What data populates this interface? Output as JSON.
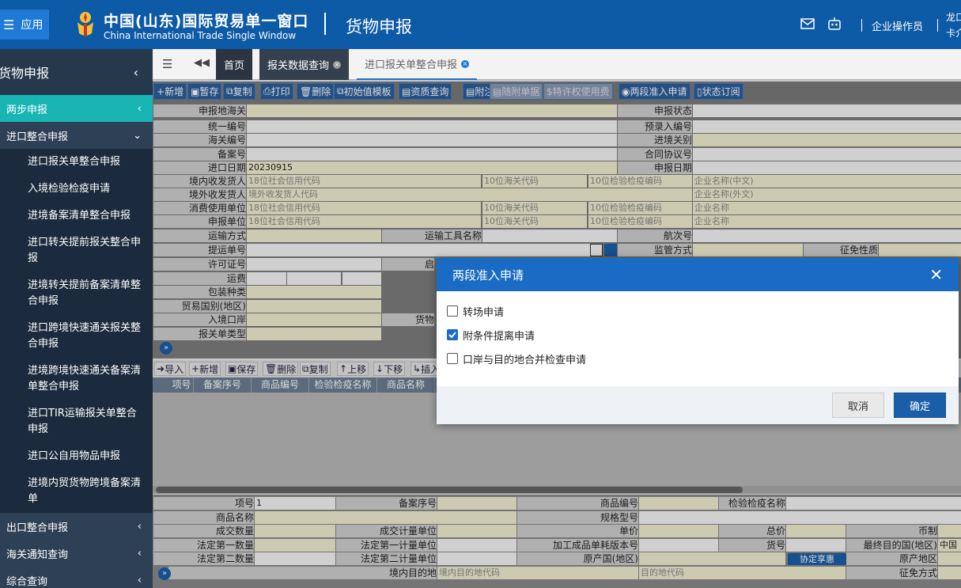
{
  "app": {
    "menu_label": "应用",
    "brand_cn": "中国(山东)国际贸易单一窗口",
    "brand_en": "China International Trade Single Window",
    "module": "货物申报",
    "operator": "企业操作员",
    "user_line1": "龙口",
    "user_line2": "卡介"
  },
  "sidebar": {
    "title": "货物申报",
    "groups": [
      {
        "label": "两步申报",
        "state": "active"
      },
      {
        "label": "进口整合申报",
        "state": "open"
      }
    ],
    "items": [
      "进口报关单整合申报",
      "入境检验检疫申请",
      "进境备案清单整合申报",
      "进口转关提前报关整合申报",
      "进境转关提前备案清单整合申报",
      "进口跨境快速通关报关整合申报",
      "进境跨境快速通关备案清单整合申报",
      "进口TIR运输报关单整合申报",
      "进口公自用物品申报",
      "进境内贸货物跨境备案清单"
    ],
    "bottom_groups": [
      "出口整合申报",
      "海关通知查询",
      "综合查询"
    ]
  },
  "tabs": {
    "home": "首页",
    "tab1": "报关数据查询",
    "tab2": "进口报关单整合申报"
  },
  "toolbar": [
    "新增",
    "暂存",
    "复制",
    "打印",
    "删除",
    "初始值模板",
    "资质查询",
    "附注",
    "随附单据",
    "特许权使用费",
    "两段准入申请",
    "状态订阅"
  ],
  "form": {
    "labels": {
      "customs": "申报地海关",
      "status": "申报状态",
      "unified_no": "统一编号",
      "pre_entry": "预录入编号",
      "customs_no": "海关编号",
      "entry_exit": "进境关别",
      "record_no": "备案号",
      "contract": "合同协议号",
      "import_date": "进口日期",
      "declare_date": "申报日期",
      "consignee": "境内收发货人",
      "foreign": "境外收发货人",
      "consumer": "消费使用单位",
      "declarant": "申报单位",
      "transport": "运输方式",
      "vehicle": "运输工具名称",
      "voyage": "航次号",
      "bill": "提运单号",
      "supervision": "监管方式",
      "levy": "征免性质",
      "permit": "许可证号",
      "freight": "运费",
      "pack": "包装种类",
      "trade_country": "贸易国别(地区)",
      "port": "入境口岸",
      "decl_type": "报关单类型",
      "start": "启",
      "goods": "货物"
    },
    "values": {
      "import_date": "20230915"
    },
    "placeholders": {
      "credit_code": "18位社会信用代码",
      "customs_code": "10位海关代码",
      "ciq_code": "10位检验检疫编码",
      "name_cn": "企业名称(中文)",
      "foreign_code": "境外收发货人代码",
      "name_foreign": "企业名称(外文)",
      "name": "企业名称"
    }
  },
  "grid": {
    "buttons": [
      "导入",
      "新增",
      "保存",
      "删除",
      "复制",
      "上移",
      "下移",
      "插入"
    ],
    "headers": [
      "项号",
      "备案序号",
      "商品编号",
      "检验检疫名称",
      "商品名称"
    ]
  },
  "bottom_form": {
    "labels": {
      "item_no": "项号",
      "record_seq": "备案序号",
      "goods_code": "商品编号",
      "ciq_name": "检验检疫名称",
      "goods_name": "商品名称",
      "spec": "规格型号",
      "qty": "成交数量",
      "unit": "成交计量单位",
      "price": "单价",
      "total": "总价",
      "currency": "币制",
      "legal_qty1": "法定第一数量",
      "legal_unit1": "法定第一计量单位",
      "version": "加工成品单耗版本号",
      "goods_no": "货号",
      "dest_country": "最终目的国(地区)",
      "legal_qty2": "法定第二数量",
      "legal_unit2": "法定第二计量单位",
      "origin": "原产国(地区)",
      "origin_area": "原产地区",
      "domestic_dest": "境内目的地",
      "levy_method": "征免方式"
    },
    "values": {
      "item_no": "1",
      "dest_country": "中国"
    },
    "placeholders": {
      "domestic_dest_code": "境内目的地代码",
      "dest_code": "目的地代码"
    },
    "agreement_btn": "协定享惠"
  },
  "dialog": {
    "title": "两段准入申请",
    "options": [
      {
        "label": "转场申请",
        "checked": false
      },
      {
        "label": "附条件提离申请",
        "checked": true
      },
      {
        "label": "口岸与目的地合并检查申请",
        "checked": false
      }
    ],
    "cancel": "取消",
    "ok": "确定"
  },
  "colors": {
    "header": "#0d5aa6",
    "sidebar": "#1b2a3c",
    "active": "#19b4b4",
    "dialog_header": "#1a6bc4"
  }
}
